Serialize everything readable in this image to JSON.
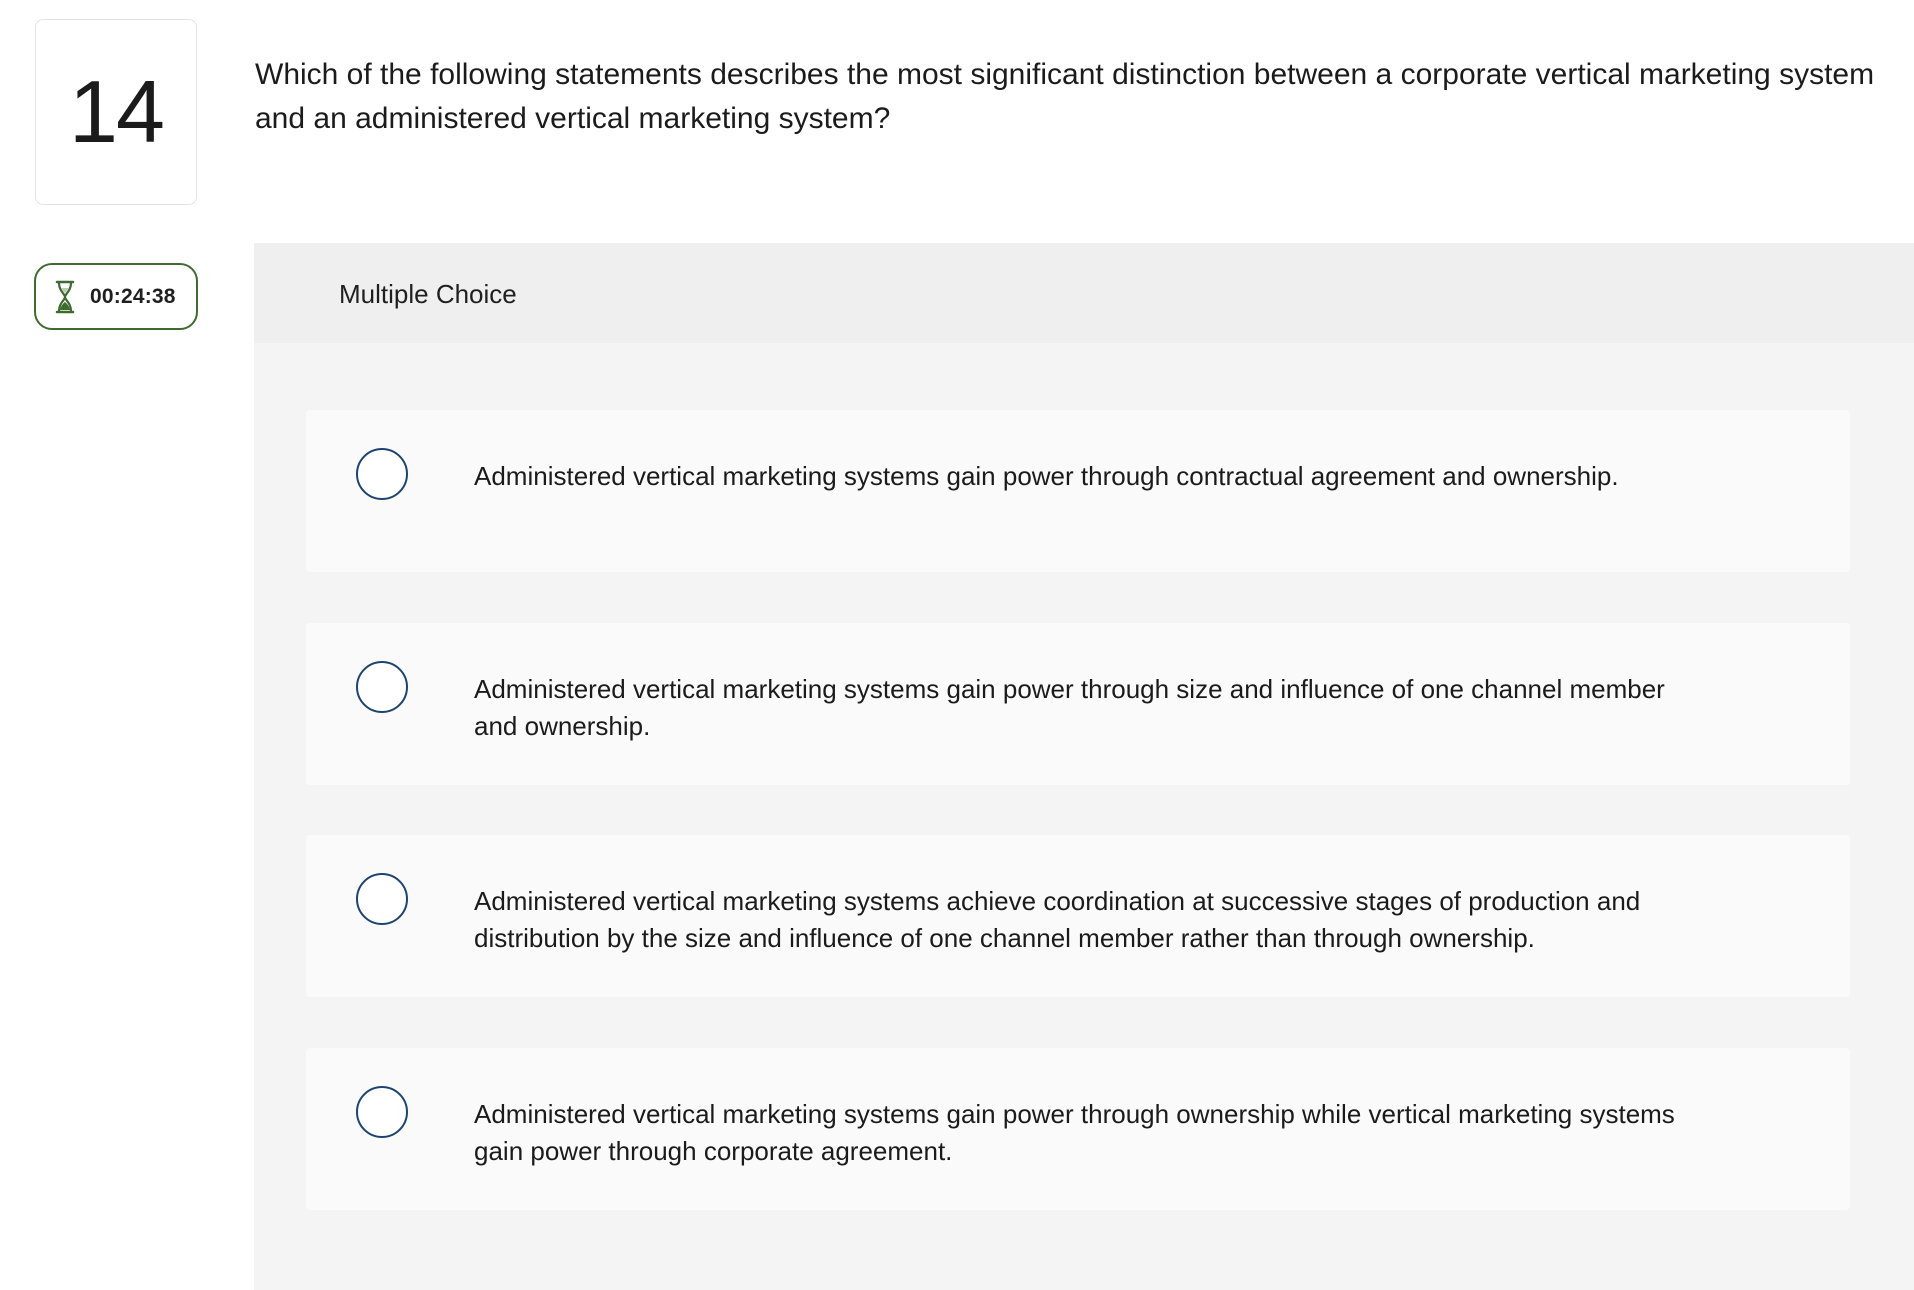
{
  "question": {
    "number": "14",
    "text": "Which of the following statements describes the most significant distinction between a corporate vertical marketing system and an administered vertical marketing system?"
  },
  "timer": {
    "icon": "hourglass-icon",
    "value": "00:24:38",
    "color": "#3f6b30"
  },
  "answer_panel": {
    "type_label": "Multiple Choice",
    "options": [
      {
        "text": "Administered vertical marketing systems gain power through contractual agreement and ownership."
      },
      {
        "text": "Administered vertical marketing systems gain power through size and influence of one channel member and ownership."
      },
      {
        "text": "Administered vertical marketing systems achieve coordination at successive stages of production and distribution by the size and influence of one channel member rather than through ownership."
      },
      {
        "text": "Administered vertical marketing systems gain power through ownership while vertical marketing systems gain power through corporate agreement."
      }
    ]
  },
  "colors": {
    "radio_border": "#1d4470",
    "panel_bg": "#f4f4f4",
    "option_bg": "#fafafa"
  }
}
